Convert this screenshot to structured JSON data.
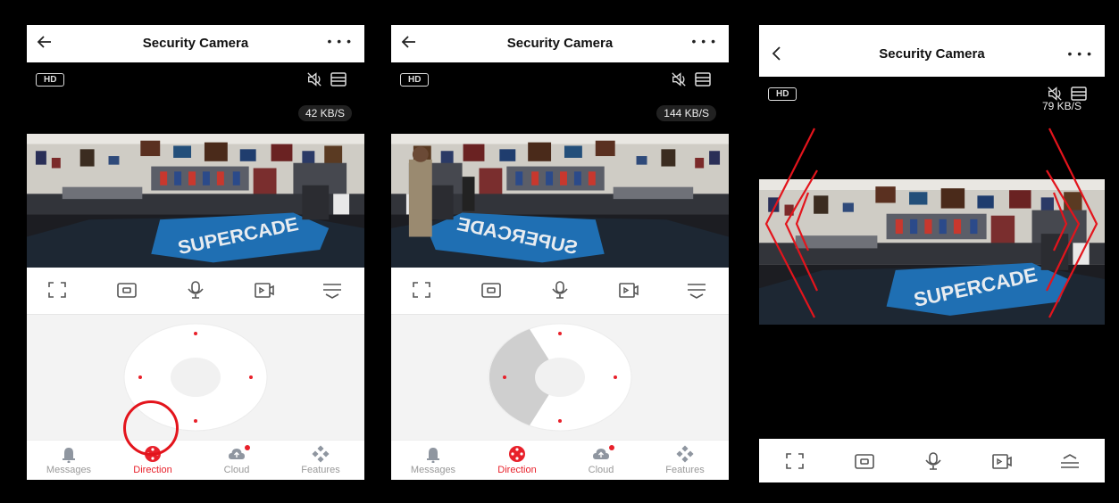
{
  "screens": [
    {
      "title": "Security Camera",
      "quality_badge": "HD",
      "speed": "42 KB/S",
      "tabs": [
        {
          "label": "Messages",
          "active": false
        },
        {
          "label": "Direction",
          "active": true
        },
        {
          "label": "Cloud",
          "active": false
        },
        {
          "label": "Features",
          "active": false
        }
      ]
    },
    {
      "title": "Security Camera",
      "quality_badge": "HD",
      "speed": "144 KB/S",
      "tabs": [
        {
          "label": "Messages",
          "active": false
        },
        {
          "label": "Direction",
          "active": true
        },
        {
          "label": "Cloud",
          "active": false
        },
        {
          "label": "Features",
          "active": false
        }
      ]
    },
    {
      "title": "Security Camera",
      "quality_badge": "HD",
      "speed": "79 KB/S"
    }
  ],
  "colors": {
    "accent": "#e8202a",
    "annotation": "#e3141c",
    "inactive_tab": "#999999"
  },
  "icons": [
    "back-arrow-icon",
    "more-icon",
    "mute-icon",
    "quality-icon",
    "fullscreen-icon",
    "snapshot-icon",
    "microphone-icon",
    "record-icon",
    "menu-icon",
    "bell-icon",
    "direction-icon",
    "cloud-icon",
    "features-icon"
  ]
}
